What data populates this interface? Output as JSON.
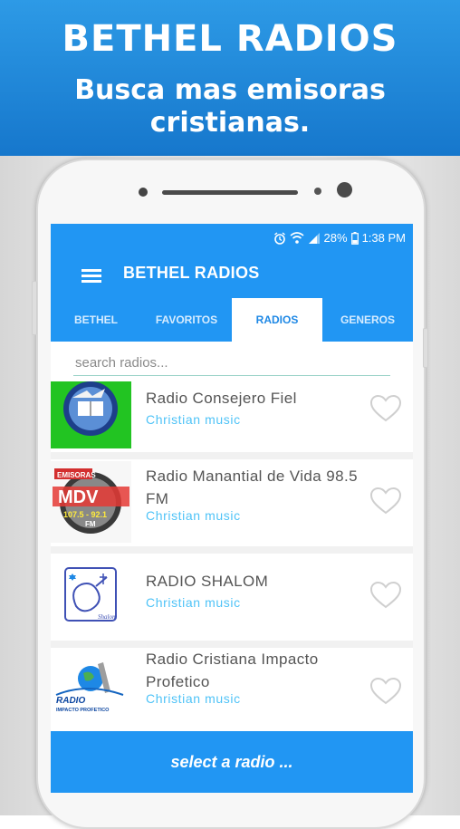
{
  "promo": {
    "title": "BETHEL RADIOS",
    "subtitle_line1": "Busca mas emisoras",
    "subtitle_line2": "cristianas."
  },
  "status_bar": {
    "battery": "28%",
    "time": "1:38 PM"
  },
  "app_bar": {
    "title": "BETHEL RADIOS"
  },
  "tabs": [
    {
      "label": "BETHEL",
      "active": false
    },
    {
      "label": "FAVORITOS",
      "active": false
    },
    {
      "label": "RADIOS",
      "active": true
    },
    {
      "label": "GENEROS",
      "active": false
    }
  ],
  "search": {
    "placeholder": "search radios..."
  },
  "radios": [
    {
      "name": "Radio Consejero Fiel",
      "genre": "Christian music",
      "logo": "globe-book-logo"
    },
    {
      "name": "Radio Manantial de Vida 98.5 FM",
      "genre": "Christian music",
      "logo_text": "MDV",
      "logo_freq": "107.5 - 92.1",
      "logo_band": "FM",
      "logo_top": "EMISORAS"
    },
    {
      "name": "RADIO SHALOM",
      "genre": "Christian music",
      "logo": "shalom-dove-logo",
      "logo_text": "Shalom"
    },
    {
      "name": "Radio Cristiana Impacto Profetico",
      "genre": "Christian music",
      "logo_text": "RADIO",
      "logo_sub": "IMPACTO PROFETICO"
    }
  ],
  "footer": {
    "label": "select a radio ..."
  },
  "colors": {
    "primary": "#2196f3",
    "accent_text": "#4fc3f7"
  }
}
